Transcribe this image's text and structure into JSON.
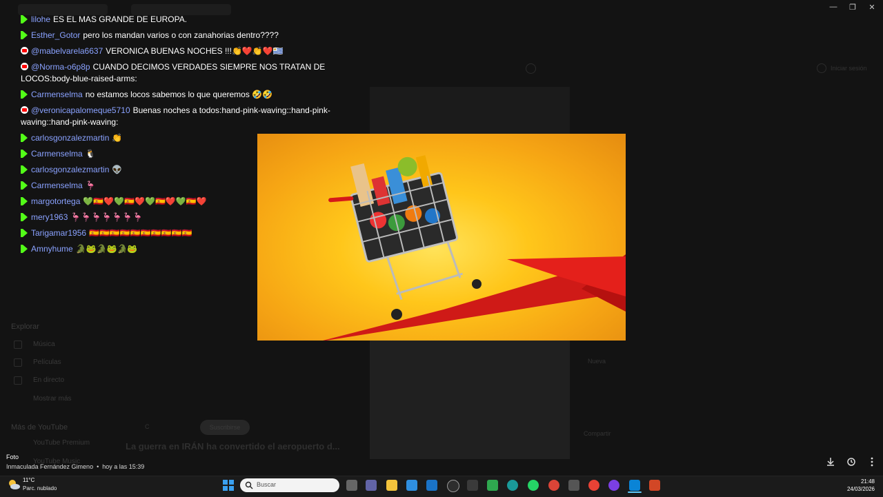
{
  "chat": {
    "messages": [
      {
        "platform": "kick",
        "user": "lilohe",
        "text": "ES EL MAS GRANDE DE EUROPA."
      },
      {
        "platform": "kick",
        "user": "Esther_Gotor",
        "text": "pero los mandan varios o con zanahorias dentro????"
      },
      {
        "platform": "youtube",
        "user": "@mabelvarela6637",
        "text": "VERONICA BUENAS NOCHES !!!👏❤️👏❤️🇺🇾"
      },
      {
        "platform": "youtube",
        "user": "@Norma-o6p8p",
        "text": "CUANDO DECIMOS VERDADES SIEMPRE NOS TRATAN DE LOCOS:body-blue-raised-arms:"
      },
      {
        "platform": "kick",
        "user": "Carmenselma",
        "text": "no estamos locos sabemos lo que queremos 🤣🤣"
      },
      {
        "platform": "youtube",
        "user": "@veronicapalomeque5710",
        "text": "Buenas noches a todos:hand-pink-waving::hand-pink-waving::hand-pink-waving:"
      },
      {
        "platform": "kick",
        "user": "carlosgonzalezmartin",
        "text": "👏"
      },
      {
        "platform": "kick",
        "user": "Carmenselma",
        "text": "🐧"
      },
      {
        "platform": "kick",
        "user": "carlosgonzalezmartin",
        "text": "👽"
      },
      {
        "platform": "kick",
        "user": "Carmenselma",
        "text": "🦩"
      },
      {
        "platform": "kick",
        "user": "margotortega",
        "text": "💚🇪🇸❤️💚🇪🇸❤️💚🇪🇸❤️💚🇪🇸❤️"
      },
      {
        "platform": "kick",
        "user": "mery1963",
        "text": "🦩🦩🦩🦩🦩🦩🦩"
      },
      {
        "platform": "kick",
        "user": "Tarigamar1956",
        "text": "🇪🇸🇪🇸🇪🇸🇪🇸🇪🇸🇪🇸🇪🇸🇪🇸🇪🇸🇪🇸"
      },
      {
        "platform": "kick",
        "user": "Amnyhume",
        "text": "🐊🐸🐊🐸🐊🐸"
      }
    ]
  },
  "viewer": {
    "label": "Foto",
    "author": "Inmaculada Fernández Gimeno",
    "time": "hoy a las 15:39"
  },
  "background": {
    "explore_heading": "Explorar",
    "explore_items": [
      "Música",
      "Películas",
      "En directo",
      "Mostrar más"
    ],
    "more_heading": "Más de YouTube",
    "more_items": [
      "YouTube Premium",
      "YouTube Music"
    ],
    "video_title": "La guerra en IRÁN ha convertido el aeropuerto d...",
    "subscribe": "Suscribirse",
    "signin": "Iniciar sesión",
    "side_labels": [
      "Nueva",
      "Compartir"
    ]
  },
  "taskbar": {
    "temp": "11°C",
    "weather": "Parc. nublado",
    "search_placeholder": "Buscar",
    "time": "21:48",
    "date": "24/03/2026",
    "colors": {
      "accent": "#0078d4",
      "kick": "#53fc18",
      "youtube": "#ff0000",
      "username": "#8aa2ff"
    }
  }
}
